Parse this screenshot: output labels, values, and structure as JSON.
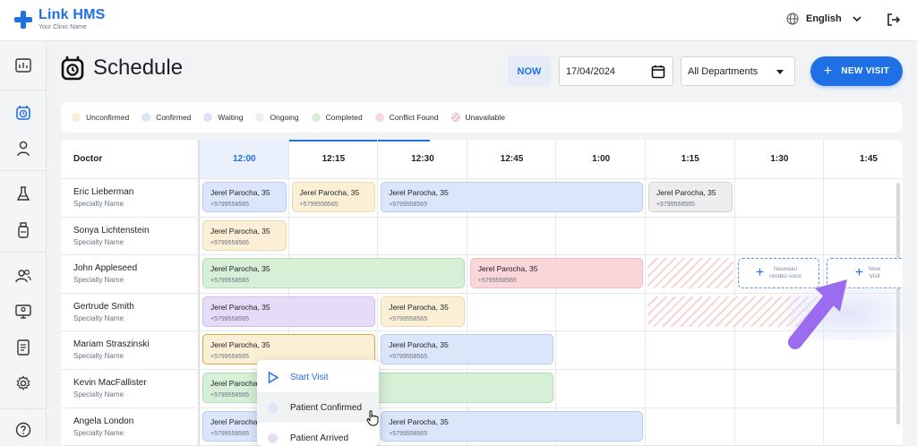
{
  "app": {
    "name": "Link HMS",
    "subtitle": "Your Clinic Name",
    "language": "English"
  },
  "header": {
    "title": "Schedule",
    "now_label": "NOW",
    "date_value": "17/04/2024",
    "department_selected": "All Departments",
    "new_visit_label": "NEW VISIT"
  },
  "legend": [
    {
      "label": "Unconfirmed",
      "color": "#fbefd6"
    },
    {
      "label": "Confirmed",
      "color": "#dbe6fb"
    },
    {
      "label": "Waiting",
      "color": "#e7dcf8"
    },
    {
      "label": "Ongoing",
      "color": "#ededed"
    },
    {
      "label": "Completed",
      "color": "#d6efd6"
    },
    {
      "label": "Conflict Found",
      "color": "#f9d6d8"
    },
    {
      "label": "Unavailable",
      "color": "#fbe3e4"
    }
  ],
  "grid": {
    "doctor_header": "Doctor",
    "times": [
      "12:00",
      "12:15",
      "12:30",
      "12:45",
      "1:00",
      "1:15",
      "1:30",
      "1:45"
    ],
    "active_time_index": 0,
    "doctors": [
      {
        "name": "Eric Lieberman",
        "specialty": "Specialty Name"
      },
      {
        "name": "Sonya Lichtenstein",
        "specialty": "Specialty Name"
      },
      {
        "name": "John Appleseed",
        "specialty": "Specialty Name"
      },
      {
        "name": "Gertrude Smith",
        "specialty": "Specialty Name"
      },
      {
        "name": "Mariam Straszinski",
        "specialty": "Specialty Name"
      },
      {
        "name": "Kevin MacFallister",
        "specialty": "Specialty Name"
      },
      {
        "name": "Angela London",
        "specialty": "Specialty Name"
      }
    ],
    "appointments": [
      {
        "row": 0,
        "start": 0,
        "span": 1,
        "status": "confirmed",
        "patient": "Jerel Parocha, 35",
        "phone": "+5799558565"
      },
      {
        "row": 0,
        "start": 1,
        "span": 1,
        "status": "unconfirmed",
        "patient": "Jerel Parocha, 35",
        "phone": "+5799558565"
      },
      {
        "row": 0,
        "start": 2,
        "span": 3,
        "status": "confirmed",
        "patient": "Jerel Parocha, 35",
        "phone": "+5799558565"
      },
      {
        "row": 0,
        "start": 5,
        "span": 1,
        "status": "ongoing",
        "patient": "Jerel Parocha, 35",
        "phone": "+5799558565"
      },
      {
        "row": 1,
        "start": 0,
        "span": 1,
        "status": "unconfirmed",
        "patient": "Jerel Parocha, 35",
        "phone": "+5799558565"
      },
      {
        "row": 2,
        "start": 0,
        "span": 3,
        "status": "completed",
        "patient": "Jerel Parocha, 35",
        "phone": "+5799558565"
      },
      {
        "row": 2,
        "start": 3,
        "span": 2,
        "status": "conflict",
        "patient": "Jerel Parocha, 35",
        "phone": "+5799558565"
      },
      {
        "row": 3,
        "start": 0,
        "span": 2,
        "status": "waiting",
        "patient": "Jerel Parocha, 35",
        "phone": "+5799558565"
      },
      {
        "row": 3,
        "start": 2,
        "span": 1,
        "status": "unconfirmed",
        "patient": "Jerel Parocha, 35",
        "phone": "+5799558565"
      },
      {
        "row": 4,
        "start": 0,
        "span": 2,
        "status": "selected",
        "patient": "Jerel Parocha, 35",
        "phone": "+5799558565"
      },
      {
        "row": 4,
        "start": 2,
        "span": 2,
        "status": "confirmed",
        "patient": "Jerel Parocha, 35",
        "phone": "+5799558565"
      },
      {
        "row": 5,
        "start": 0,
        "span": 4,
        "status": "completed",
        "patient": "Jerel Parocha, 35",
        "phone": "+5799558565"
      },
      {
        "row": 6,
        "start": 0,
        "span": 1,
        "status": "confirmed",
        "patient": "Jerel Parocha, 35",
        "phone": "+5799558565"
      },
      {
        "row": 6,
        "start": 2,
        "span": 3,
        "status": "confirmed",
        "patient": "Jerel Parocha, 35",
        "phone": "+5799558565"
      }
    ],
    "unavailable": [
      {
        "row": 2,
        "start": 5,
        "span": 1
      },
      {
        "row": 3,
        "start": 5,
        "span": 2
      }
    ],
    "new_slots": [
      {
        "row": 2,
        "start": 6,
        "label_line1": "Nouveau",
        "label_line2": "rendez-vous"
      },
      {
        "row": 2,
        "start": 7,
        "label_line1": "New",
        "label_line2": "Visit"
      }
    ]
  },
  "context_menu": {
    "items": [
      {
        "label": "Start Visit",
        "kind": "action"
      },
      {
        "label": "Patient Confirmed",
        "kind": "status",
        "color": "#dbe6fb"
      },
      {
        "label": "Patient Arrived",
        "kind": "status",
        "color": "#e7dcf8"
      }
    ]
  }
}
